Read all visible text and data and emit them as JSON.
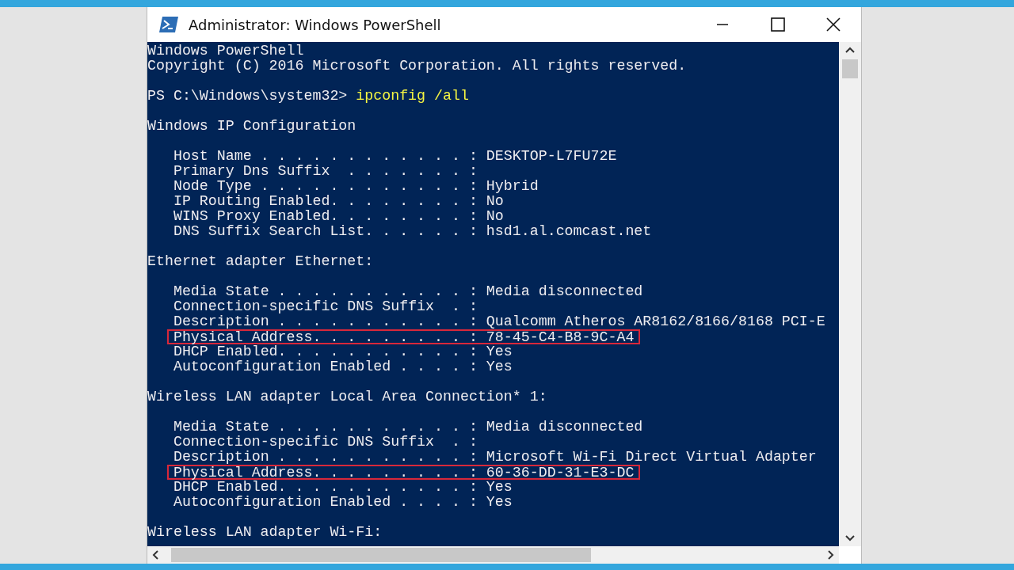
{
  "window": {
    "title": "Administrator: Windows PowerShell"
  },
  "console": {
    "lines": [
      {
        "kind": "output",
        "text": "Windows PowerShell"
      },
      {
        "kind": "output",
        "text": "Copyright (C) 2016 Microsoft Corporation. All rights reserved."
      },
      {
        "kind": "blank"
      },
      {
        "kind": "prompt",
        "prompt": "PS C:\\Windows\\system32>",
        "command": "ipconfig /all"
      },
      {
        "kind": "blank"
      },
      {
        "kind": "output",
        "text": "Windows IP Configuration"
      },
      {
        "kind": "blank"
      },
      {
        "kind": "output",
        "text": "   Host Name . . . . . . . . . . . . : DESKTOP-L7FU72E"
      },
      {
        "kind": "output",
        "text": "   Primary Dns Suffix  . . . . . . . :"
      },
      {
        "kind": "output",
        "text": "   Node Type . . . . . . . . . . . . : Hybrid"
      },
      {
        "kind": "output",
        "text": "   IP Routing Enabled. . . . . . . . : No"
      },
      {
        "kind": "output",
        "text": "   WINS Proxy Enabled. . . . . . . . : No"
      },
      {
        "kind": "output",
        "text": "   DNS Suffix Search List. . . . . . : hsd1.al.comcast.net"
      },
      {
        "kind": "blank"
      },
      {
        "kind": "output",
        "text": "Ethernet adapter Ethernet:"
      },
      {
        "kind": "blank"
      },
      {
        "kind": "output",
        "text": "   Media State . . . . . . . . . . . : Media disconnected"
      },
      {
        "kind": "output",
        "text": "   Connection-specific DNS Suffix  . :"
      },
      {
        "kind": "output",
        "text": "   Description . . . . . . . . . . . : Qualcomm Atheros AR8162/8166/8168 PCI-E"
      },
      {
        "kind": "output",
        "text": "   Physical Address. . . . . . . . . : 78-45-C4-B8-9C-A4",
        "highlighted": true
      },
      {
        "kind": "output",
        "text": "   DHCP Enabled. . . . . . . . . . . : Yes"
      },
      {
        "kind": "output",
        "text": "   Autoconfiguration Enabled . . . . : Yes"
      },
      {
        "kind": "blank"
      },
      {
        "kind": "output",
        "text": "Wireless LAN adapter Local Area Connection* 1:"
      },
      {
        "kind": "blank"
      },
      {
        "kind": "output",
        "text": "   Media State . . . . . . . . . . . : Media disconnected"
      },
      {
        "kind": "output",
        "text": "   Connection-specific DNS Suffix  . :"
      },
      {
        "kind": "output",
        "text": "   Description . . . . . . . . . . . : Microsoft Wi-Fi Direct Virtual Adapter"
      },
      {
        "kind": "output",
        "text": "   Physical Address. . . . . . . . . : 60-36-DD-31-E3-DC",
        "highlighted": true
      },
      {
        "kind": "output",
        "text": "   DHCP Enabled. . . . . . . . . . . : Yes"
      },
      {
        "kind": "output",
        "text": "   Autoconfiguration Enabled . . . . : Yes"
      },
      {
        "kind": "blank"
      },
      {
        "kind": "output",
        "text": "Wireless LAN adapter Wi-Fi:"
      }
    ]
  }
}
